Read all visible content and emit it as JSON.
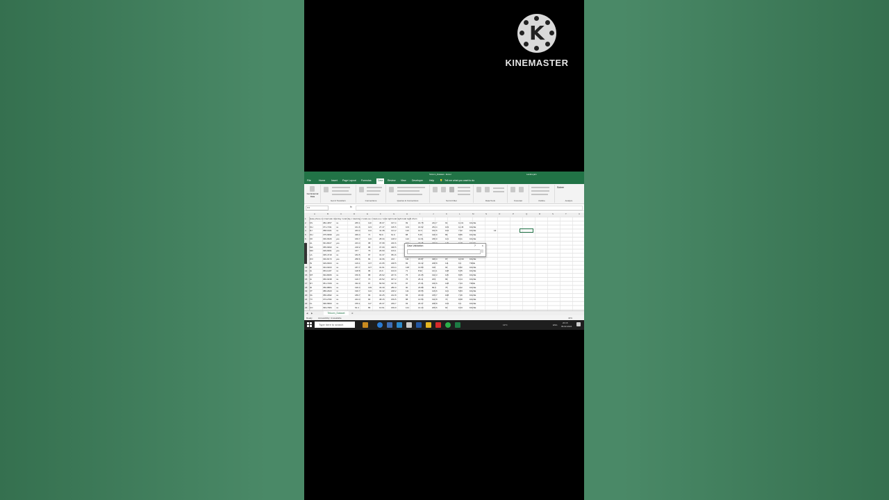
{
  "watermark": {
    "brand": "KINEMASTER",
    "logo_letter": "K"
  },
  "excel": {
    "title": "Telcom_Dataset - Excel",
    "user": "Lavitra jain",
    "tabs": [
      "File",
      "Home",
      "Insert",
      "Page Layout",
      "Formulas",
      "Data",
      "Review",
      "View",
      "Developer",
      "Help"
    ],
    "active_tab": "Data",
    "tell_me": "Tell me what you want to do",
    "ribbon_groups": [
      "Get & Transform",
      "Connections",
      "Queries & Connections",
      "Sort & Filter",
      "Data Tools",
      "Forecast",
      "Outline",
      "Analyze"
    ],
    "get_data": "Get External Data",
    "solver": "Solver",
    "name_box": "O4",
    "fx": "fx",
    "columns": [
      "A",
      "B",
      "C",
      "D",
      "E",
      "F",
      "G",
      "H",
      "I",
      "J",
      "K",
      "L",
      "M",
      "N",
      "O",
      "P",
      "Q",
      "R",
      "S",
      "T",
      "U"
    ],
    "header_row": "state   phone no internatio total day i total day c total day c total eve c total eve c total night total night total night churn",
    "rows": [
      [
        "2",
        "KS",
        "382-4657",
        "no",
        "265.1",
        "110",
        "45.07",
        "197.4",
        "99",
        "16.78",
        "244.7",
        "91",
        "11.01",
        "FALSE"
      ],
      [
        "3",
        "OH",
        "371-7191",
        "no",
        "161.6",
        "123",
        "27.47",
        "195.5",
        "103",
        "16.62",
        "254.4",
        "103",
        "11.45",
        "FALSE"
      ],
      [
        "4",
        "NJ",
        "358-1921",
        "no",
        "243.4",
        "114",
        "41.38",
        "121.2",
        "110",
        "10.3",
        "162.6",
        "104",
        "7.32",
        "FALSE"
      ],
      [
        "5",
        "OH",
        "375-9999",
        "yes",
        "299.4",
        "71",
        "50.9",
        "61.9",
        "88",
        "5.26",
        "196.9",
        "89",
        "8.86",
        "FALSE"
      ],
      [
        "6",
        "OK",
        "330-6626",
        "yes",
        "166.7",
        "113",
        "28.34",
        "148.3",
        "122",
        "12.61",
        "186.9",
        "121",
        "8.41",
        "FALSE"
      ],
      [
        "7",
        "AL",
        "391-8027",
        "yes",
        "223.4",
        "98",
        "37.98",
        "220.6",
        "101",
        "18.75",
        "203.9",
        "118",
        "9.18",
        "FALSE"
      ],
      [
        "8",
        "MA",
        "355-9993",
        "no",
        "218.2",
        "88",
        "37.09",
        "348.5",
        "108",
        "29.62",
        "212.6",
        "118",
        "9.57",
        "FALSE"
      ],
      [
        "9",
        "MO",
        "329-9001",
        "yes",
        "157",
        "79",
        "26.69",
        "103.1",
        "94",
        "8.76",
        "211.8",
        "96",
        "9.53",
        "FALSE"
      ],
      [
        "10",
        "LA",
        "335-4719",
        "no",
        "184.5",
        "97",
        "31.37",
        "351.6",
        "80",
        "29.89",
        "215.8",
        "90",
        "9.71",
        "FALSE"
      ],
      [
        "11",
        "WV",
        "330-8173",
        "yes",
        "258.6",
        "84",
        "43.96",
        "222",
        "111",
        "18.87",
        "326.4",
        "97",
        "14.69",
        "FALSE"
      ],
      [
        "12",
        "IN",
        "329-6603",
        "no",
        "129.1",
        "137",
        "21.95",
        "228.5",
        "83",
        "19.42",
        "208.8",
        "111",
        "9.4",
        "TRUE"
      ],
      [
        "13",
        "RI",
        "344-9403",
        "no",
        "187.7",
        "127",
        "31.91",
        "163.4",
        "148",
        "13.89",
        "196",
        "94",
        "8.82",
        "FALSE"
      ],
      [
        "14",
        "IA",
        "363-1107",
        "no",
        "128.8",
        "96",
        "21.9",
        "104.9",
        "71",
        "8.92",
        "141.1",
        "128",
        "6.35",
        "FALSE"
      ],
      [
        "15",
        "MT",
        "394-8006",
        "no",
        "156.6",
        "88",
        "26.62",
        "247.6",
        "75",
        "21.05",
        "192.3",
        "115",
        "8.65",
        "FALSE"
      ],
      [
        "16",
        "IA",
        "366-9238",
        "no",
        "120.7",
        "70",
        "20.52",
        "307.2",
        "76",
        "26.11",
        "203",
        "99",
        "9.14",
        "FALSE"
      ],
      [
        "17",
        "NY",
        "351-7269",
        "no",
        "332.9",
        "67",
        "56.59",
        "317.8",
        "97",
        "27.01",
        "160.6",
        "128",
        "7.23",
        "TRUE"
      ],
      [
        "18",
        "ID",
        "350-8884",
        "no",
        "196.4",
        "139",
        "33.39",
        "280.9",
        "90",
        "23.88",
        "89.3",
        "75",
        "4.02",
        "FALSE"
      ],
      [
        "19",
        "VT",
        "386-2923",
        "no",
        "190.7",
        "114",
        "32.42",
        "218.2",
        "111",
        "18.55",
        "129.6",
        "121",
        "5.83",
        "FALSE"
      ],
      [
        "20",
        "VA",
        "356-2992",
        "no",
        "189.7",
        "66",
        "32.25",
        "212.8",
        "65",
        "18.09",
        "165.7",
        "108",
        "7.46",
        "FALSE"
      ],
      [
        "21",
        "TX",
        "373-2782",
        "no",
        "224.4",
        "90",
        "38.15",
        "159.5",
        "88",
        "13.56",
        "192.8",
        "74",
        "8.68",
        "FALSE"
      ],
      [
        "22",
        "FL",
        "396-5800",
        "no",
        "155.1",
        "117",
        "26.37",
        "239.7",
        "93",
        "20.37",
        "208.8",
        "133",
        "9.4",
        "FALSE"
      ],
      [
        "23",
        "CO",
        "393-7984",
        "no",
        "62.4",
        "89",
        "10.61",
        "169.9",
        "121",
        "14.44",
        "209.6",
        "64",
        "9.43",
        "FALSE"
      ]
    ],
    "cell_o4": "13",
    "dialog": {
      "title": "Data Validation",
      "help": "?",
      "close": "×"
    },
    "sheet_tab": "Telcom_Dataset",
    "status_ready": "Ready",
    "status_accessibility": "Accessibility: Unavailable",
    "zoom": "40%",
    "taskbar": {
      "search_placeholder": "Type here to search",
      "weather": "13°C",
      "lang": "ENG",
      "time": "20:15",
      "date": "09-02-2024"
    }
  }
}
